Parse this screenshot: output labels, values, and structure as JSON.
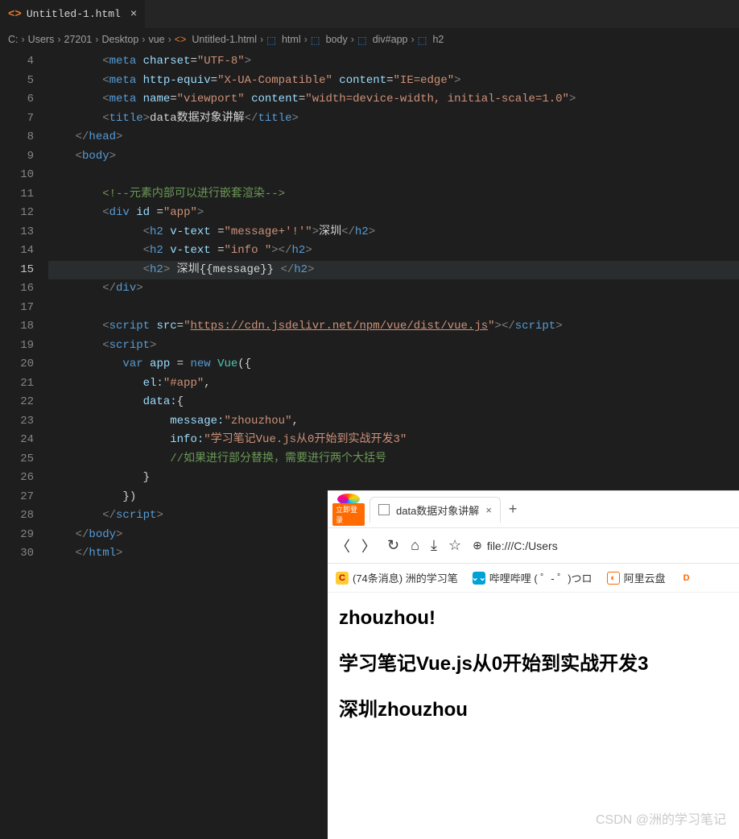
{
  "tab": {
    "filename": "Untitled-1.html"
  },
  "breadcrumb": {
    "parts": [
      "C:",
      "Users",
      "27201",
      "Desktop",
      "vue",
      "Untitled-1.html",
      "html",
      "body",
      "div#app",
      "h2"
    ]
  },
  "gutter": {
    "start": 4,
    "end": 30,
    "current": 15
  },
  "code_tokens": {
    "l4": {
      "t1": "<",
      "t2": "meta",
      "t3": " charset",
      "t4": "=",
      "t5": "\"UTF-8\"",
      "t6": ">"
    },
    "l5": {
      "t1": "<",
      "t2": "meta",
      "t3": " http-equiv",
      "t4": "=",
      "t5": "\"X-UA-Compatible\"",
      "t6": " content",
      "t7": "=",
      "t8": "\"IE=edge\"",
      "t9": ">"
    },
    "l6": {
      "t1": "<",
      "t2": "meta",
      "t3": " name",
      "t4": "=",
      "t5": "\"viewport\"",
      "t6": " content",
      "t7": "=",
      "t8": "\"width=device-width, initial-scale=1.0\"",
      "t9": ">"
    },
    "l7": {
      "t1": "<",
      "t2": "title",
      "t3": ">",
      "t4": "data数据对象讲解",
      "t5": "</",
      "t6": "title",
      "t7": ">"
    },
    "l8": {
      "t1": "</",
      "t2": "head",
      "t3": ">"
    },
    "l9": {
      "t1": "<",
      "t2": "body",
      "t3": ">"
    },
    "l11": {
      "t1": "<!--元素内部可以进行嵌套渲染-->"
    },
    "l12": {
      "t1": "<",
      "t2": "div",
      "t3": " id ",
      "t4": "=",
      "t5": "\"app\"",
      "t6": ">"
    },
    "l13": {
      "t1": "<",
      "t2": "h2",
      "t3": " v-text ",
      "t4": "=",
      "t5": "\"message+'!'\"",
      "t6": ">",
      "t7": "深圳",
      "t8": "</",
      "t9": "h2",
      "t10": ">"
    },
    "l14": {
      "t1": "<",
      "t2": "h2",
      "t3": " v-text ",
      "t4": "=",
      "t5": "\"info \"",
      "t6": "></",
      "t7": "h2",
      "t8": ">"
    },
    "l15": {
      "t1": "<",
      "t2": "h2",
      "t3": ">",
      "t4": " 深圳{{message}} ",
      "t5": "</",
      "t6": "h2",
      "t7": ">"
    },
    "l16": {
      "t1": "</",
      "t2": "div",
      "t3": ">"
    },
    "l18": {
      "t1": "<",
      "t2": "script",
      "t3": " src",
      "t4": "=",
      "t5": "\"",
      "t6": "https://cdn.jsdelivr.net/npm/vue/dist/vue.js",
      "t7": "\"",
      "t8": "></",
      "t9": "script",
      "t10": ">"
    },
    "l19": {
      "t1": "<",
      "t2": "script",
      "t3": ">"
    },
    "l20": {
      "t1": "var",
      "t2": " app ",
      "t3": "= ",
      "t4": "new",
      "t5": " Vue",
      "t6": "({"
    },
    "l21": {
      "t1": "el:",
      "t2": "\"#app\"",
      "t3": ","
    },
    "l22": {
      "t1": "data:",
      "t2": "{"
    },
    "l23": {
      "t1": "message:",
      "t2": "\"zhouzhou\"",
      "t3": ","
    },
    "l24": {
      "t1": "info:",
      "t2": "\"学习笔记Vue.js从0开始到实战开发3\""
    },
    "l25": {
      "t1": "//如果进行部分替换，需要进行两个大括号"
    },
    "l26": {
      "t1": "}"
    },
    "l27": {
      "t1": "})"
    },
    "l28": {
      "t1": "</",
      "t2": "script",
      "t3": ">"
    },
    "l29": {
      "t1": "</",
      "t2": "body",
      "t3": ">"
    },
    "l30": {
      "t1": "</",
      "t2": "html",
      "t3": ">"
    }
  },
  "browser": {
    "logo_text": "立即登录",
    "tab_title": "data数据对象讲解",
    "url": "file:///C:/Users",
    "bookmarks": {
      "b1": "(74条消息) 洲的学习笔",
      "b2": "哔哩哔哩 ( ゜- ゜)つロ",
      "b3": "阿里云盘"
    },
    "content": {
      "h1": "zhouzhou!",
      "h2": "学习笔记Vue.js从0开始到实战开发3",
      "h3": "深圳zhouzhou"
    }
  },
  "watermark": "CSDN @洲的学习笔记"
}
